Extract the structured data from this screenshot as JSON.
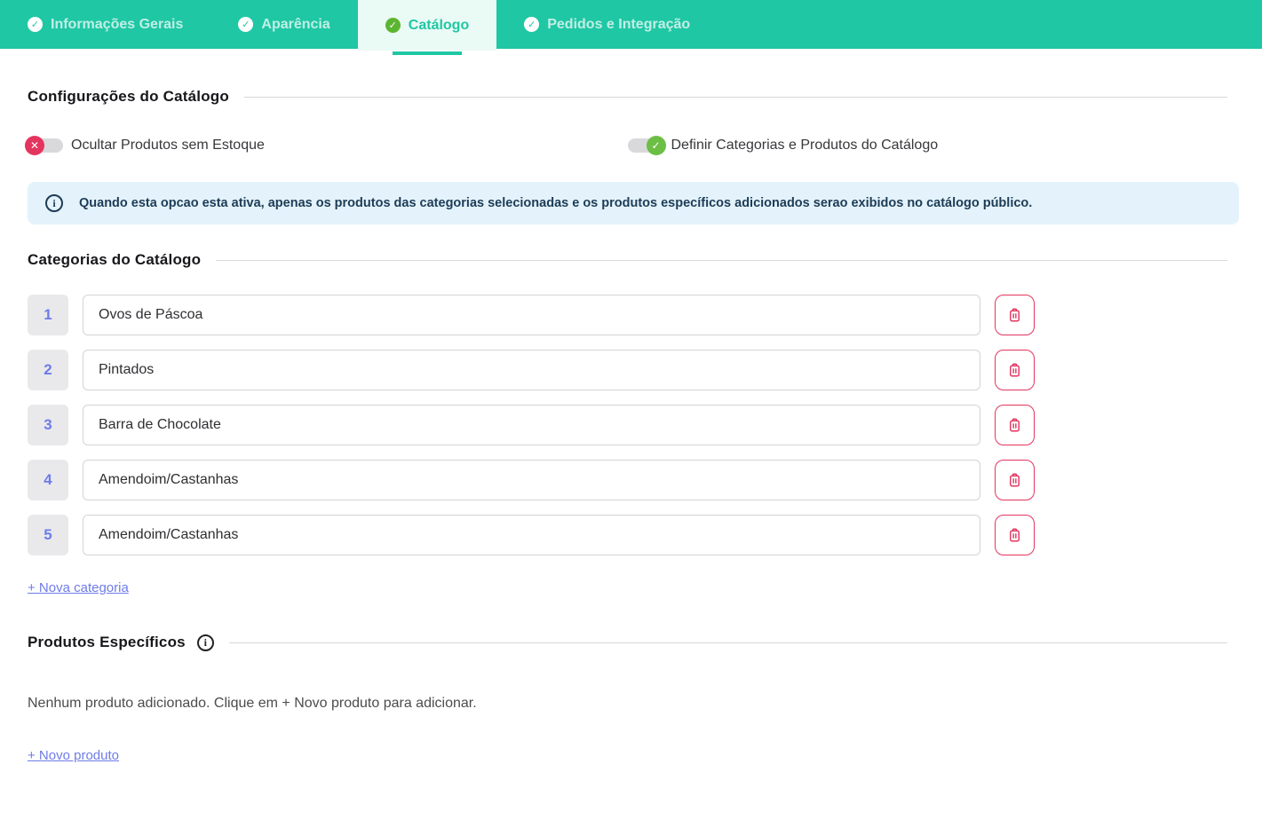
{
  "tabs": [
    {
      "label": "Informações Gerais",
      "state": "completed"
    },
    {
      "label": "Aparência",
      "state": "completed"
    },
    {
      "label": "Catálogo",
      "state": "active"
    },
    {
      "label": "Pedidos e Integração",
      "state": "completed"
    }
  ],
  "tab_check_glyph": "✓",
  "sections": {
    "settings_title": "Configurações do Catálogo",
    "categories_title": "Categorias do Catálogo",
    "products_title": "Produtos Específicos"
  },
  "toggles": {
    "hide_out_of_stock": {
      "label": "Ocultar Produtos sem Estoque",
      "state": "off",
      "glyph": "✕"
    },
    "define_catalog": {
      "label": "Definir Categorias e Produtos do Catálogo",
      "state": "on",
      "glyph": "✓"
    }
  },
  "info_banner": {
    "icon_glyph": "i",
    "text": "Quando esta opcao esta ativa, apenas os produtos das categorias selecionadas e os produtos específicos adicionados serao exibidos no catálogo público."
  },
  "categories": [
    {
      "number": "1",
      "value": "Ovos de Páscoa"
    },
    {
      "number": "2",
      "value": "Pintados"
    },
    {
      "number": "3",
      "value": "Barra de Chocolate"
    },
    {
      "number": "4",
      "value": "Amendoim/Castanhas"
    },
    {
      "number": "5",
      "value": "Amendoim/Castanhas"
    }
  ],
  "links": {
    "new_category": "+ Nova categoria",
    "new_product": "+ Novo produto"
  },
  "products_empty_text": "Nenhum produto adicionado. Clique em + Novo produto para adicionar.",
  "colors": {
    "teal": "#1fc7a4",
    "active_tab_bg": "#eafaf5",
    "success_green": "#5cb531",
    "toggle_green": "#6cbf44",
    "danger_crimson": "#e4355f",
    "link_indigo": "#6e7ce8",
    "info_bg": "#e4f3fb",
    "info_text": "#1d3c56"
  }
}
